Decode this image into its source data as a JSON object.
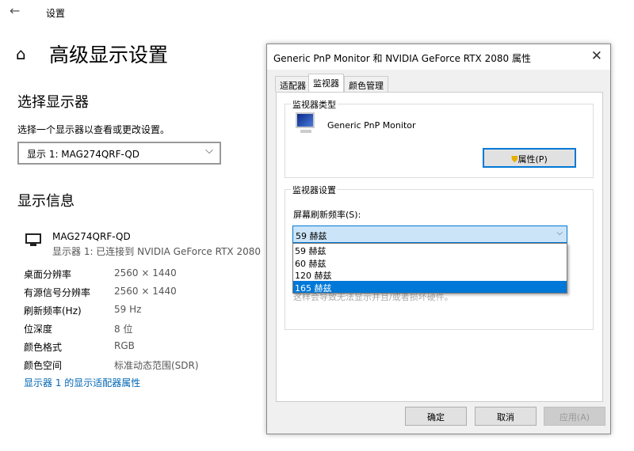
{
  "settings": {
    "title": "设置",
    "page_title": "高级显示设置",
    "select_heading": "选择显示器",
    "select_desc": "选择一个显示器以查看或更改设置。",
    "display_select": "显示 1: MAG274QRF-QD",
    "info_heading": "显示信息",
    "monitor_name": "MAG274QRF-QD",
    "monitor_sub": "显示器 1: 已连接到 NVIDIA GeForce RTX 2080",
    "info_rows": [
      {
        "label": "桌面分辨率",
        "value": "2560 × 1440"
      },
      {
        "label": "有源信号分辨率",
        "value": "2560 × 1440"
      },
      {
        "label": "刷新频率(Hz)",
        "value": "59 Hz"
      },
      {
        "label": "位深度",
        "value": "8 位"
      },
      {
        "label": "颜色格式",
        "value": "RGB"
      },
      {
        "label": "颜色空间",
        "value": "标准动态范围(SDR)"
      }
    ],
    "adapter_link": "显示器 1 的显示适配器属性"
  },
  "dialog": {
    "title": "Generic PnP Monitor 和 NVIDIA GeForce RTX 2080 属性",
    "close": "✕",
    "tabs": [
      "适配器",
      "监视器",
      "颜色管理"
    ],
    "monitor_type_label": "监视器类型",
    "monitor_type": "Generic PnP Monitor",
    "properties_button": "属性(P)",
    "settings_label": "监视器设置",
    "refresh_label": "屏幕刷新频率(S):",
    "refresh_value": "59 赫兹",
    "refresh_options": [
      "59 赫兹",
      "60 赫兹",
      "120 赫兹",
      "165 赫兹"
    ],
    "warning_partial": "这样会导致无法显示并且/或者损坏硬件。",
    "ok": "确定",
    "cancel": "取消",
    "apply": "应用(A)"
  }
}
